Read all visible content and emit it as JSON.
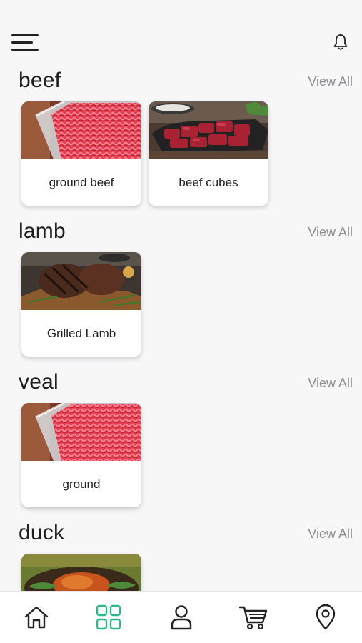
{
  "header": {
    "menu_icon": "hamburger-menu-icon",
    "bell_icon": "notification-bell-icon"
  },
  "sections": [
    {
      "title": "beef",
      "view_all": "View All",
      "items": [
        {
          "label": "ground beef",
          "image": "minced-meat"
        },
        {
          "label": "beef cubes",
          "image": "beef-cubes"
        }
      ]
    },
    {
      "title": "lamb",
      "view_all": "View All",
      "items": [
        {
          "label": "Grilled Lamb",
          "image": "grilled-lamb"
        }
      ]
    },
    {
      "title": "veal",
      "view_all": "View All",
      "items": [
        {
          "label": "ground",
          "image": "minced-meat"
        }
      ]
    },
    {
      "title": "duck",
      "view_all": "View All",
      "items": [
        {
          "label": "",
          "image": "roast-duck"
        }
      ]
    }
  ],
  "bottom_nav": [
    {
      "name": "home",
      "icon": "home-icon",
      "active": false
    },
    {
      "name": "categories",
      "icon": "grid-icon",
      "active": true
    },
    {
      "name": "profile",
      "icon": "user-icon",
      "active": false
    },
    {
      "name": "cart",
      "icon": "cart-icon",
      "active": false
    },
    {
      "name": "location",
      "icon": "location-pin-icon",
      "active": false
    }
  ],
  "colors": {
    "accent": "#2bb88a",
    "icon": "#222222",
    "muted": "#8e8e93",
    "background": "#f7f7f8"
  }
}
